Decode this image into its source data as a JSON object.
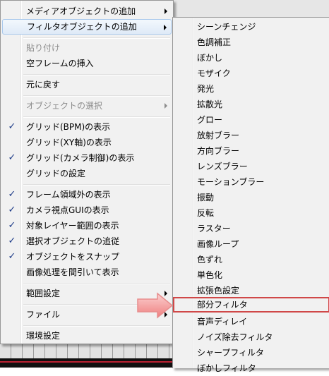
{
  "main_menu": {
    "items": [
      {
        "label": "メディアオブジェクトの追加",
        "submenu": true,
        "disabled": false,
        "checked": false
      },
      {
        "label": "フィルタオブジェクトの追加",
        "submenu": true,
        "disabled": false,
        "checked": false,
        "highlighted": true
      },
      {
        "label": "貼り付け",
        "disabled": true
      },
      {
        "label": "空フレームの挿入",
        "disabled": false
      },
      {
        "label": "元に戻す",
        "disabled": false
      },
      {
        "label": "オブジェクトの選択",
        "submenu": true,
        "disabled": true
      },
      {
        "label": "グリッド(BPM)の表示",
        "checked": true
      },
      {
        "label": "グリッド(XY軸)の表示",
        "checked": false
      },
      {
        "label": "グリッド(カメラ制御)の表示",
        "checked": true
      },
      {
        "label": "グリッドの設定",
        "checked": false
      },
      {
        "label": "フレーム領域外の表示",
        "checked": true
      },
      {
        "label": "カメラ視点GUIの表示",
        "checked": true
      },
      {
        "label": "対象レイヤー範囲の表示",
        "checked": true
      },
      {
        "label": "選択オブジェクトの追従",
        "checked": true
      },
      {
        "label": "オブジェクトをスナップ",
        "checked": true
      },
      {
        "label": "画像処理を間引いて表示",
        "checked": false
      },
      {
        "label": "範囲設定",
        "submenu": true
      },
      {
        "label": "ファイル",
        "submenu": true
      },
      {
        "label": "環境設定"
      }
    ]
  },
  "sub_menu": {
    "items": [
      "シーンチェンジ",
      "色調補正",
      "ぼかし",
      "モザイク",
      "発光",
      "拡散光",
      "グロー",
      "放射ブラー",
      "方向ブラー",
      "レンズブラー",
      "モーションブラー",
      "振動",
      "反転",
      "ラスター",
      "画像ループ",
      "色ずれ",
      "単色化",
      "拡張色設定",
      "部分フィルタ",
      "音声ディレイ",
      "ノイズ除去フィルタ",
      "シャープフィルタ",
      "ぼかしフィルタ"
    ],
    "selected_index": 18
  },
  "colors": {
    "check": "#1d3b88",
    "selection_box": "#d04848",
    "pointer_arrow": "#f08a8a"
  },
  "icons": {
    "check": "✓",
    "submenu_arrow": "triangle-right"
  }
}
